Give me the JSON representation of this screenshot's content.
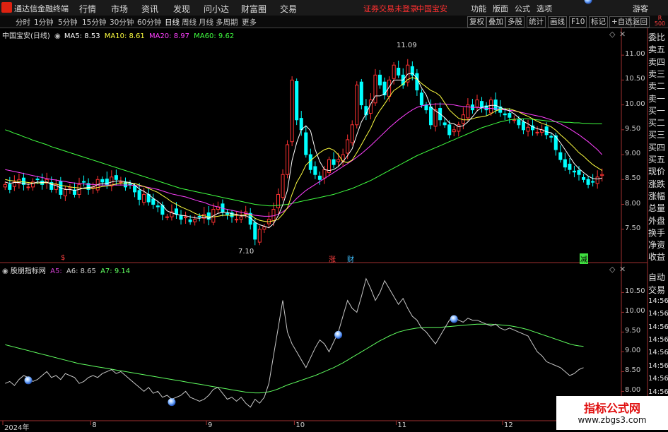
{
  "topbar": {
    "app_title": "通达信金融终端",
    "menus": [
      "行情",
      "市场",
      "资讯",
      "发现",
      "问小达",
      "财富圈",
      "交易"
    ],
    "warning": "证券交易未登录",
    "stock_name": "中国宝安",
    "right_menus": [
      "功能",
      "版面",
      "公式",
      "选项"
    ],
    "guest": "游客"
  },
  "tabs": [
    "分时",
    "1分钟",
    "5分钟",
    "15分钟",
    "30分钟",
    "60分钟",
    "日线",
    "周线",
    "月线",
    "多周期",
    "更多"
  ],
  "active_tab": "日线",
  "right_buttons": [
    "复权",
    "叠加",
    "多股",
    "统计",
    "画线",
    "F10",
    "标记",
    "+自选",
    "返回"
  ],
  "main_legend": {
    "title": "中国宝安(日线)",
    "items": [
      {
        "label": "MA5: 8.53",
        "color": "#ffffff"
      },
      {
        "label": "MA10: 8.61",
        "color": "#ffff40"
      },
      {
        "label": "MA20: 8.97",
        "color": "#ff40ff"
      },
      {
        "label": "MA60: 9.62",
        "color": "#40ff40"
      }
    ]
  },
  "sub_legend": {
    "title": "股朋指标网",
    "items": [
      {
        "label": "A5:",
        "color": "#d040d0"
      },
      {
        "label": "A6: 8.65",
        "color": "#d0d0d0"
      },
      {
        "label": "A7: 9.14",
        "color": "#60ff60"
      }
    ]
  },
  "side_panel": [
    "委比",
    "卖五",
    "卖四",
    "卖三",
    "卖二",
    "卖一",
    "买一",
    "买二",
    "买三",
    "买四",
    "买五",
    "现价",
    "涨跌",
    "涨幅",
    "总量",
    "外盘",
    "换手",
    "净资",
    "收益"
  ],
  "side_panel2": [
    "自动",
    "交易",
    "14:56",
    "14:56",
    "14:56",
    "14:56",
    "14:56",
    "14:56",
    "14:56",
    "14:56"
  ],
  "annotations": {
    "high": "11.09",
    "low": "7.10",
    "marks": [
      "$",
      "涨",
      "财",
      "减"
    ]
  },
  "x_axis_labels": [
    "2024年",
    "8",
    "9",
    "10",
    "11",
    "12"
  ],
  "badge": {
    "title": "指标公式网",
    "url": "www.zbgs3.com"
  },
  "corner_label": "R 500",
  "colors": {
    "up": "#ff3232",
    "down": "#00ffff",
    "ma5": "#ffffff",
    "ma10": "#ffff40",
    "ma20": "#ff40ff",
    "ma60": "#40ff40",
    "sub_line": "#c8c8c8",
    "sub_ma": "#60ff60"
  },
  "chart_data": [
    {
      "type": "candlestick",
      "title": "中国宝安(日线)",
      "ylim": [
        7.0,
        11.3
      ],
      "yticks": [
        7.5,
        8.0,
        8.5,
        9.0,
        9.5,
        10.0,
        10.5,
        11.0
      ],
      "close": [
        8.4,
        8.3,
        8.45,
        8.5,
        8.4,
        8.35,
        8.45,
        8.5,
        8.4,
        8.5,
        8.3,
        8.4,
        8.2,
        8.3,
        8.35,
        8.2,
        8.4,
        8.45,
        8.3,
        8.35,
        8.5,
        8.45,
        8.4,
        8.55,
        8.5,
        8.45,
        8.35,
        8.4,
        8.25,
        8.1,
        8.2,
        8.05,
        8.0,
        7.95,
        7.8,
        7.75,
        7.85,
        7.8,
        7.7,
        7.75,
        7.65,
        7.7,
        7.75,
        7.8,
        7.7,
        7.9,
        7.95,
        7.85,
        7.8,
        7.75,
        7.7,
        7.75,
        7.85,
        7.6,
        7.3,
        7.5,
        7.55,
        7.7,
        7.9,
        8.2,
        8.6,
        9.2,
        10.5,
        9.7,
        9.5,
        9.0,
        8.7,
        8.6,
        8.5,
        8.7,
        8.9,
        8.8,
        8.9,
        9.0,
        9.3,
        9.6,
        10.4,
        10.0,
        9.8,
        10.1,
        10.6,
        10.4,
        10.2,
        10.5,
        10.8,
        10.6,
        10.4,
        10.8,
        10.6,
        10.3,
        10.0,
        9.9,
        9.6,
        9.9,
        9.7,
        9.6,
        9.4,
        9.5,
        9.6,
        9.8,
        10.0,
        9.9,
        10.1,
        9.95,
        9.9,
        10.1,
        9.9,
        9.85,
        9.8,
        9.75,
        9.7,
        9.6,
        9.5,
        9.55,
        9.5,
        9.45,
        9.5,
        9.4,
        9.35,
        9.1,
        8.9,
        8.75,
        8.7,
        8.65,
        8.6,
        8.5,
        8.4,
        8.45,
        8.55,
        8.6
      ],
      "ma5": [
        8.45,
        8.42,
        8.44,
        8.44,
        8.42,
        8.4,
        8.42,
        8.45,
        8.44,
        8.45,
        8.4,
        8.38,
        8.33,
        8.3,
        8.3,
        8.28,
        8.3,
        8.33,
        8.34,
        8.35,
        8.4,
        8.42,
        8.42,
        8.45,
        8.47,
        8.47,
        8.45,
        8.44,
        8.39,
        8.31,
        8.26,
        8.2,
        8.12,
        8.06,
        7.98,
        7.87,
        7.83,
        7.8,
        7.78,
        7.77,
        7.75,
        7.73,
        7.72,
        7.74,
        7.72,
        7.77,
        7.82,
        7.84,
        7.84,
        7.81,
        7.8,
        7.77,
        7.77,
        7.73,
        7.64,
        7.59,
        7.56,
        7.53,
        7.61,
        7.77,
        7.99,
        8.28,
        8.88,
        9.24,
        9.5,
        9.58,
        9.48,
        9.1,
        8.86,
        8.7,
        8.68,
        8.7,
        8.76,
        8.86,
        8.98,
        9.12,
        9.4,
        9.66,
        9.82,
        10.02,
        10.18,
        10.18,
        10.22,
        10.36,
        10.5,
        10.5,
        10.5,
        10.62,
        10.64,
        10.54,
        10.34,
        10.2,
        9.96,
        9.88,
        9.82,
        9.74,
        9.64,
        9.62,
        9.56,
        9.58,
        9.66,
        9.76,
        9.88,
        9.95,
        9.97,
        9.99,
        9.99,
        9.95,
        9.91,
        9.88,
        9.82,
        9.74,
        9.67,
        9.62,
        9.56,
        9.52,
        9.5,
        9.46,
        9.44,
        9.36,
        9.24,
        9.1,
        8.96,
        8.82,
        8.72,
        8.64,
        8.57,
        8.52,
        8.51,
        8.53
      ],
      "ma10": [
        8.5,
        8.48,
        8.47,
        8.46,
        8.45,
        8.44,
        8.43,
        8.43,
        8.43,
        8.44,
        8.42,
        8.41,
        8.38,
        8.37,
        8.35,
        8.34,
        8.33,
        8.32,
        8.32,
        8.32,
        8.34,
        8.36,
        8.37,
        8.39,
        8.41,
        8.43,
        8.43,
        8.43,
        8.42,
        8.39,
        8.36,
        8.32,
        8.28,
        8.24,
        8.18,
        8.12,
        8.05,
        8.0,
        7.95,
        7.91,
        7.87,
        7.82,
        7.78,
        7.77,
        7.75,
        7.75,
        7.76,
        7.78,
        7.78,
        7.78,
        7.78,
        7.78,
        7.79,
        7.79,
        7.72,
        7.68,
        7.66,
        7.65,
        7.67,
        7.7,
        7.8,
        7.93,
        8.2,
        8.44,
        8.6,
        8.79,
        8.88,
        8.96,
        9.04,
        9.1,
        9.13,
        9.09,
        9.0,
        8.86,
        8.84,
        8.89,
        9.04,
        9.2,
        9.37,
        9.53,
        9.74,
        9.89,
        10.02,
        10.16,
        10.29,
        10.35,
        10.42,
        10.51,
        10.55,
        10.52,
        10.43,
        10.36,
        10.29,
        10.25,
        10.18,
        10.04,
        9.9,
        9.81,
        9.73,
        9.7,
        9.7,
        9.72,
        9.75,
        9.76,
        9.78,
        9.82,
        9.88,
        9.91,
        9.92,
        9.92,
        9.89,
        9.86,
        9.81,
        9.77,
        9.72,
        9.67,
        9.63,
        9.6,
        9.56,
        9.49,
        9.4,
        9.32,
        9.23,
        9.14,
        9.04,
        8.97,
        8.88,
        8.8,
        8.74,
        8.68
      ],
      "ma20": [
        8.7,
        8.68,
        8.66,
        8.64,
        8.62,
        8.6,
        8.58,
        8.56,
        8.54,
        8.52,
        8.5,
        8.49,
        8.47,
        8.46,
        8.44,
        8.43,
        8.42,
        8.41,
        8.4,
        8.4,
        8.39,
        8.39,
        8.39,
        8.39,
        8.39,
        8.39,
        8.39,
        8.39,
        8.38,
        8.37,
        8.36,
        8.34,
        8.32,
        8.3,
        8.27,
        8.24,
        8.21,
        8.19,
        8.17,
        8.15,
        8.12,
        8.09,
        8.06,
        8.04,
        8.0,
        7.97,
        7.95,
        7.92,
        7.9,
        7.88,
        7.86,
        7.84,
        7.82,
        7.8,
        7.78,
        7.77,
        7.76,
        7.76,
        7.77,
        7.8,
        7.85,
        7.92,
        8.02,
        8.12,
        8.2,
        8.28,
        8.34,
        8.4,
        8.46,
        8.52,
        8.58,
        8.64,
        8.7,
        8.76,
        8.82,
        8.88,
        8.95,
        9.02,
        9.1,
        9.18,
        9.27,
        9.36,
        9.45,
        9.54,
        9.62,
        9.7,
        9.77,
        9.84,
        9.9,
        9.95,
        9.98,
        10.0,
        10.01,
        10.02,
        10.02,
        10.02,
        10.01,
        10.0,
        9.98,
        9.97,
        9.96,
        9.95,
        9.95,
        9.94,
        9.93,
        9.93,
        9.92,
        9.91,
        9.9,
        9.89,
        9.88,
        9.86,
        9.84,
        9.82,
        9.8,
        9.78,
        9.76,
        9.73,
        9.7,
        9.66,
        9.62,
        9.57,
        9.52,
        9.46,
        9.4,
        9.33,
        9.26,
        9.18,
        9.1,
        9.0
      ],
      "ma60": [
        9.5,
        9.47,
        9.43,
        9.4,
        9.36,
        9.33,
        9.29,
        9.26,
        9.23,
        9.2,
        9.16,
        9.13,
        9.1,
        9.07,
        9.04,
        9.01,
        8.98,
        8.95,
        8.92,
        8.89,
        8.86,
        8.83,
        8.8,
        8.77,
        8.74,
        8.71,
        8.68,
        8.65,
        8.62,
        8.59,
        8.56,
        8.53,
        8.5,
        8.47,
        8.44,
        8.41,
        8.38,
        8.35,
        8.32,
        8.3,
        8.28,
        8.26,
        8.24,
        8.22,
        8.2,
        8.18,
        8.16,
        8.14,
        8.12,
        8.1,
        8.08,
        8.06,
        8.04,
        8.02,
        8.0,
        7.99,
        7.98,
        7.97,
        7.97,
        7.98,
        7.99,
        8.0,
        8.02,
        8.04,
        8.06,
        8.08,
        8.1,
        8.12,
        8.14,
        8.16,
        8.18,
        8.2,
        8.23,
        8.26,
        8.29,
        8.32,
        8.36,
        8.4,
        8.44,
        8.48,
        8.53,
        8.58,
        8.63,
        8.68,
        8.73,
        8.78,
        8.83,
        8.88,
        8.93,
        8.98,
        9.02,
        9.06,
        9.1,
        9.14,
        9.18,
        9.22,
        9.26,
        9.3,
        9.34,
        9.38,
        9.42,
        9.46,
        9.5,
        9.54,
        9.57,
        9.6,
        9.63,
        9.66,
        9.68,
        9.7,
        9.71,
        9.72,
        9.72,
        9.72,
        9.71,
        9.7,
        9.69,
        9.68,
        9.67,
        9.66,
        9.66,
        9.65,
        9.65,
        9.64,
        9.64,
        9.63,
        9.63,
        9.62,
        9.62,
        9.62
      ]
    },
    {
      "type": "line",
      "title": "股朋指标网",
      "ylim": [
        7.9,
        10.9
      ],
      "yticks": [
        8.0,
        8.5,
        9.0,
        9.5,
        10.0,
        10.5
      ],
      "series": [
        {
          "name": "A6",
          "values": [
            8.2,
            8.25,
            8.15,
            8.3,
            8.4,
            8.35,
            8.25,
            8.3,
            8.4,
            8.5,
            8.35,
            8.4,
            8.3,
            8.45,
            8.4,
            8.35,
            8.2,
            8.25,
            8.35,
            8.4,
            8.35,
            8.45,
            8.5,
            8.55,
            8.45,
            8.5,
            8.4,
            8.3,
            8.2,
            8.1,
            8.0,
            8.1,
            7.95,
            8.0,
            7.85,
            7.9,
            7.8,
            7.85,
            7.9,
            8.0,
            7.85,
            7.8,
            7.75,
            7.8,
            7.9,
            8.05,
            8.1,
            7.95,
            7.8,
            7.85,
            7.75,
            7.85,
            7.7,
            7.6,
            7.8,
            7.7,
            7.85,
            8.2,
            8.9,
            9.6,
            10.3,
            9.5,
            9.2,
            9.0,
            8.8,
            8.6,
            8.85,
            9.1,
            9.3,
            9.2,
            9.0,
            9.25,
            9.5,
            9.9,
            10.3,
            10.1,
            10.0,
            10.4,
            10.85,
            10.6,
            10.3,
            10.5,
            10.8,
            10.6,
            10.4,
            10.2,
            10.35,
            10.1,
            9.9,
            9.8,
            9.6,
            9.5,
            9.35,
            9.2,
            9.4,
            9.6,
            9.8,
            9.9,
            9.8,
            9.75,
            9.85,
            9.8,
            9.8,
            9.75,
            9.7,
            9.65,
            9.7,
            9.6,
            9.55,
            9.6,
            9.55,
            9.5,
            9.45,
            9.4,
            9.2,
            9.0,
            8.9,
            8.75,
            8.7,
            8.65,
            8.6,
            8.5,
            8.4,
            8.45,
            8.55,
            8.6
          ]
        },
        {
          "name": "A7",
          "values": [
            9.18,
            9.15,
            9.12,
            9.09,
            9.06,
            9.03,
            9.0,
            8.97,
            8.94,
            8.91,
            8.88,
            8.85,
            8.82,
            8.79,
            8.76,
            8.73,
            8.7,
            8.68,
            8.66,
            8.64,
            8.62,
            8.6,
            8.58,
            8.56,
            8.54,
            8.52,
            8.5,
            8.48,
            8.46,
            8.44,
            8.42,
            8.4,
            8.38,
            8.36,
            8.34,
            8.32,
            8.3,
            8.28,
            8.26,
            8.24,
            8.22,
            8.2,
            8.18,
            8.16,
            8.14,
            8.12,
            8.1,
            8.08,
            8.06,
            8.04,
            8.02,
            8.0,
            7.98,
            7.97,
            7.96,
            7.96,
            7.97,
            7.99,
            8.02,
            8.06,
            8.11,
            8.16,
            8.2,
            8.24,
            8.28,
            8.32,
            8.36,
            8.4,
            8.45,
            8.5,
            8.55,
            8.6,
            8.66,
            8.72,
            8.79,
            8.86,
            8.93,
            9.0,
            9.07,
            9.14,
            9.21,
            9.28,
            9.34,
            9.4,
            9.45,
            9.5,
            9.53,
            9.56,
            9.58,
            9.6,
            9.61,
            9.62,
            9.62,
            9.62,
            9.62,
            9.63,
            9.64,
            9.65,
            9.66,
            9.67,
            9.68,
            9.69,
            9.7,
            9.7,
            9.7,
            9.7,
            9.69,
            9.68,
            9.67,
            9.66,
            9.64,
            9.62,
            9.59,
            9.56,
            9.52,
            9.48,
            9.44,
            9.4,
            9.36,
            9.32,
            9.28,
            9.24,
            9.2,
            9.17,
            9.15,
            9.14
          ]
        }
      ],
      "signals": [
        5,
        36,
        72,
        97,
        126
      ]
    }
  ]
}
